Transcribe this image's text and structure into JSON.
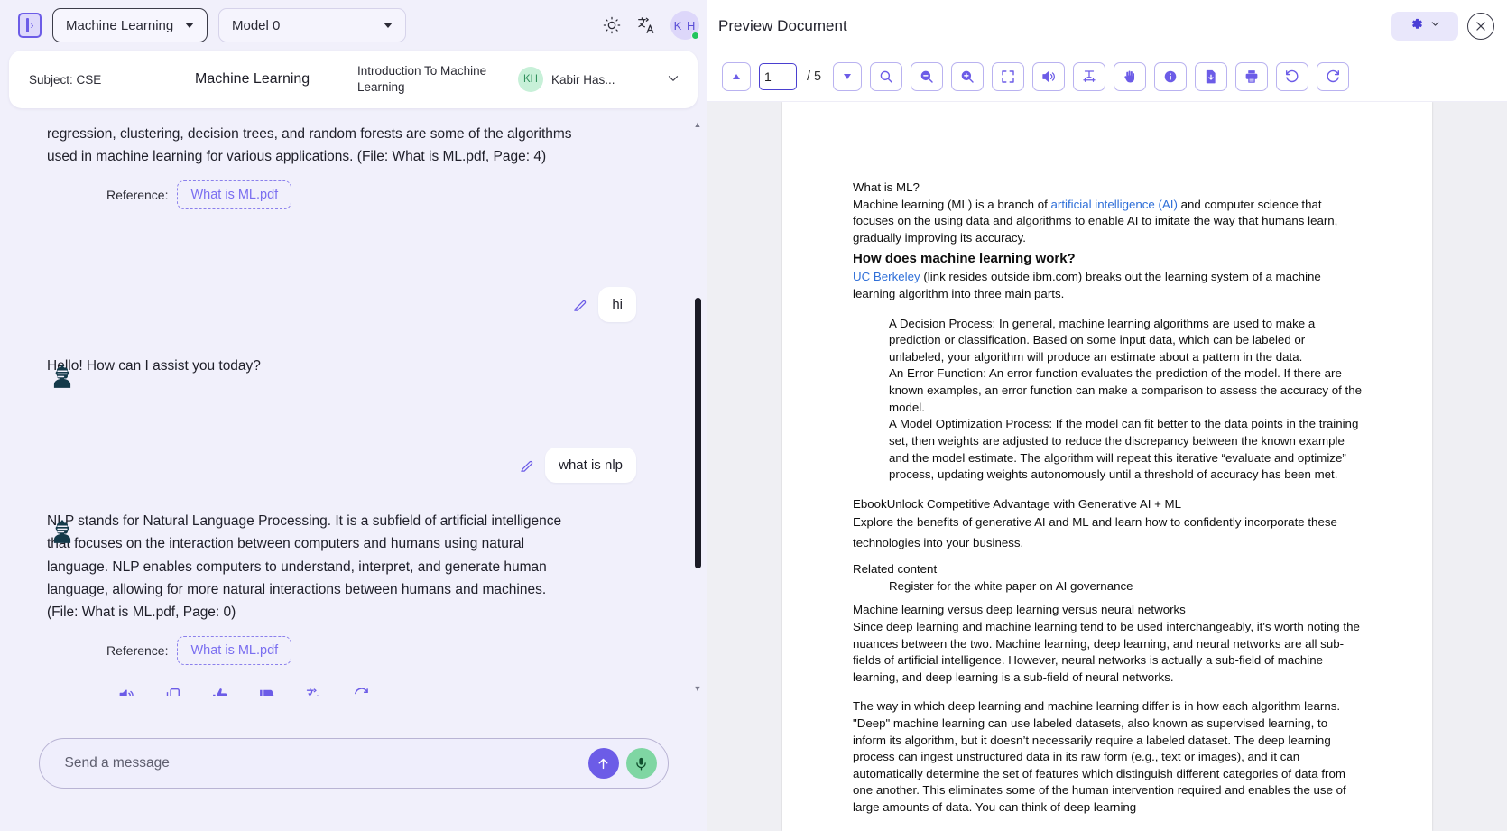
{
  "left": {
    "toggle_icon": "sidebar-expand-icon",
    "course_select": {
      "value": "Machine Learning",
      "icon": "chevron-down-icon"
    },
    "model_select": {
      "value": "Model 0",
      "icon": "chevron-down-icon"
    },
    "theme_icon": "brightness-sun-icon",
    "translate_icon": "translate-icon",
    "avatar": {
      "initials": "K H",
      "status": "online"
    },
    "course_card": {
      "subject": "Subject: CSE",
      "course": "Machine Learning",
      "chapter": "Introduction To Machine Learning",
      "user_initials": "KH",
      "user_name": "Kabir Has...",
      "caret_icon": "chevron-down-icon"
    },
    "messages": [
      {
        "role": "assistant",
        "text": "regression, clustering, decision trees, and random forests are some of the algorithms used in machine learning for various applications. (File: What is ML.pdf, Page: 4)",
        "reference_label": "Reference:",
        "reference_file": "What is ML.pdf"
      },
      {
        "role": "user",
        "text": "hi"
      },
      {
        "role": "assistant",
        "text": "Hello! How can I assist you today?"
      },
      {
        "role": "user",
        "text": "what is nlp"
      },
      {
        "role": "assistant",
        "text": "NLP stands for Natural Language Processing. It is a subfield of artificial intelligence that focuses on the interaction between computers and humans using natural language. NLP enables computers to understand, interpret, and generate human language, allowing for more natural interactions between humans and machines. (File: What is ML.pdf, Page: 0)",
        "reference_label": "Reference:",
        "reference_file": "What is ML.pdf"
      }
    ],
    "action_icons": [
      "speaker-icon",
      "copy-icon",
      "thumbs-up-icon",
      "thumbs-down-icon",
      "translate-icon",
      "refresh-icon"
    ],
    "composer": {
      "placeholder": "Send a message",
      "value": "",
      "send_icon": "arrow-up-icon",
      "mic_icon": "microphone-icon"
    },
    "scrollbar": {
      "up_icon": "scroll-up-arrow-icon",
      "down_icon": "scroll-down-arrow-icon"
    }
  },
  "right": {
    "title": "Preview Document",
    "settings_icon": "gear-icon",
    "settings_caret_icon": "chevron-down-icon",
    "close_icon": "close-icon",
    "toolbar": {
      "prev_page_icon": "triangle-up-icon",
      "page_value": "1",
      "page_total": "/ 5",
      "next_page_icon": "triangle-down-icon",
      "search_icon": "search-icon",
      "zoom_out_icon": "zoom-out-icon",
      "zoom_in_icon": "zoom-in-icon",
      "fit_screen_icon": "fit-to-screen-icon",
      "read_aloud_icon": "speaker-icon",
      "text_select_icon": "text-select-icon",
      "pan_icon": "hand-pan-icon",
      "info_icon": "info-icon",
      "download_icon": "download-document-icon",
      "print_icon": "print-icon",
      "rotate_left_icon": "rotate-left-icon",
      "rotate_right_icon": "rotate-right-icon"
    },
    "document": {
      "heading1": "What is ML?",
      "para1_a": "Machine learning (ML) is a branch of ",
      "para1_link": "artificial intelligence (AI)",
      "para1_b": " and computer science that focuses on the using data and algorithms to enable AI to imitate the way that humans learn, gradually improving its accuracy.",
      "heading2": "How does machine learning work?",
      "para2_link": "UC Berkeley",
      "para2_rest": " (link resides outside ibm.com) breaks out the learning system of a machine learning algorithm into three main parts.",
      "bullet1": "A Decision Process: In general, machine learning algorithms are used to make a prediction or classification. Based on some input data, which can be labeled or unlabeled, your algorithm will produce an estimate about a pattern in the data.",
      "bullet2": "An Error Function: An error function evaluates the prediction of the model. If there are known examples, an error function can make a comparison to assess the accuracy of the model.",
      "bullet3": "A Model Optimization Process: If the model can fit better to the data points in the training set, then weights are adjusted to reduce the discrepancy between the known example and the model estimate. The algorithm will repeat this iterative “evaluate and optimize” process, updating weights autonomously until a threshold of accuracy has been met.",
      "ebook_title": "EbookUnlock Competitive Advantage with Generative AI + ML",
      "ebook_body": "Explore the benefits of generative AI and ML and learn how to confidently incorporate these technologies into your business.",
      "related_title": "Related content",
      "related_item": "Register for the white paper on AI governance",
      "section_title": "Machine learning versus deep learning versus neural networks",
      "section_body": "Since deep learning and machine learning tend to be used interchangeably, it's worth noting the nuances between the two. Machine learning, deep learning, and neural networks are all sub-fields of artificial intelligence. However, neural networks is actually a sub-field of machine learning, and deep learning is a sub-field of neural networks.",
      "last_para": "The way in which deep learning and machine learning differ is in how each algorithm learns. \"Deep\" machine learning can use labeled datasets, also known as supervised learning, to inform its algorithm, but it doesn’t necessarily require a labeled dataset. The deep learning process can ingest unstructured data in its raw form (e.g., text or images), and it can automatically determine the set of features which distinguish different categories of data from one another. This eliminates some of the human intervention required and enables the use of large amounts of data. You can think of deep learning"
    }
  },
  "colors": {
    "accent": "#6c5ce7",
    "left_bg": "#f1f0fb",
    "link": "#2f6fd8",
    "online": "#22c55e"
  }
}
